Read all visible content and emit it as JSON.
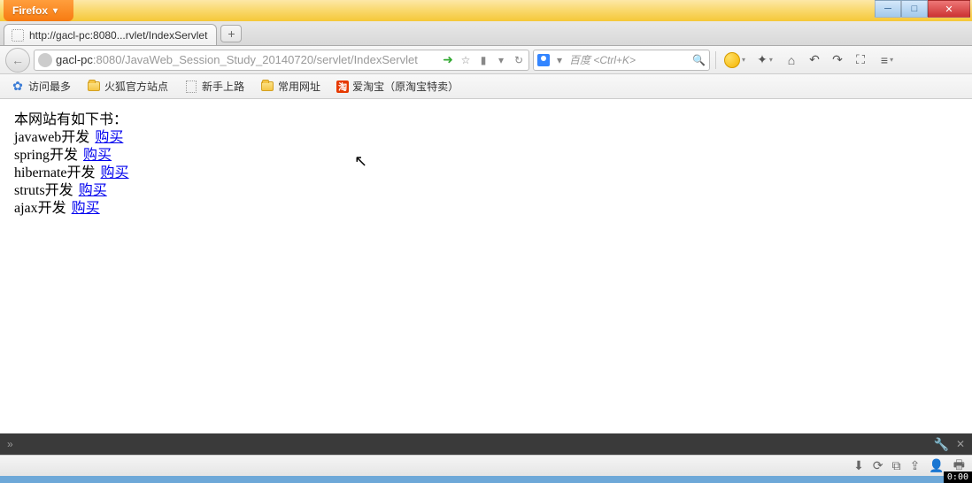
{
  "window": {
    "app_menu_label": "Firefox",
    "min_label": "─",
    "max_label": "□",
    "close_label": "✕"
  },
  "tab": {
    "title": "http://gacl-pc:8080...rvlet/IndexServlet",
    "newtab_label": "+"
  },
  "nav": {
    "back_label": "←",
    "url_host": "gacl-pc",
    "url_port": ":8080",
    "url_path": "/JavaWeb_Session_Study_20140720/servlet/IndexServlet",
    "go_label": "➜",
    "star_label": "☆",
    "device_label": "▮",
    "dropdown_label": "▾",
    "reload_label": "↻"
  },
  "search": {
    "placeholder": "百度 <Ctrl+K>",
    "engine_drop": "▾",
    "magnifier": "🔍"
  },
  "toolbar": {
    "bookmark_star": "✦",
    "home": "⌂",
    "undo": "↶",
    "redo": "↷",
    "crop": "⛶",
    "list": "≡",
    "drop": "▾"
  },
  "bookmarks": {
    "most_visited": "访问最多",
    "firefox_official": "火狐官方站点",
    "newbie": "新手上路",
    "common_sites": "常用网址",
    "taobao_label": "淘",
    "itaobao": "爱淘宝（原淘宝特卖）"
  },
  "page": {
    "heading": "本网站有如下书：",
    "buy_label": "购买",
    "books": [
      "javaweb开发",
      "spring开发",
      "hibernate开发",
      "struts开发",
      "ajax开发"
    ]
  },
  "addonbar": {
    "chevron": "»",
    "wrench": "🔧",
    "close": "✕"
  },
  "statusbar": {
    "download": "⬇",
    "sync": "⟳",
    "layers": "⧉",
    "share": "⇪",
    "person": "👤",
    "print": "🖶",
    "timer": "0:00"
  }
}
